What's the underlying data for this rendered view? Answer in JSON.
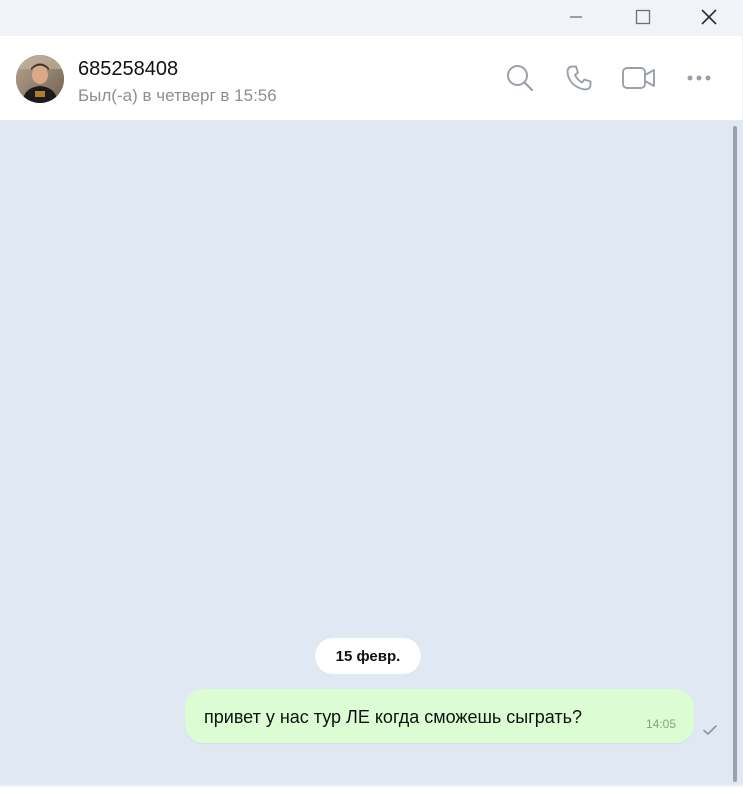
{
  "window": {
    "controls": [
      "minimize",
      "maximize",
      "close"
    ]
  },
  "header": {
    "name": "685258408",
    "status": "Был(-а) в четверг в 15:56",
    "icons": [
      "search-icon",
      "phone-icon",
      "video-camera-icon",
      "more-icon"
    ]
  },
  "chat": {
    "date_label": "15 февр.",
    "messages": [
      {
        "text": "привет у нас тур ЛЕ когда сможешь сыграть?",
        "time": "14:05",
        "outgoing": true,
        "status_icon": "single-check-icon"
      }
    ]
  },
  "colors": {
    "chat_background": "#e0e8f4",
    "outgoing_bubble": "#dcfdd4",
    "header_background": "#ffffff",
    "titlebar_background": "#f1f3f8",
    "icon_gray": "#9aa0a8",
    "time_green": "#7fa67a"
  }
}
